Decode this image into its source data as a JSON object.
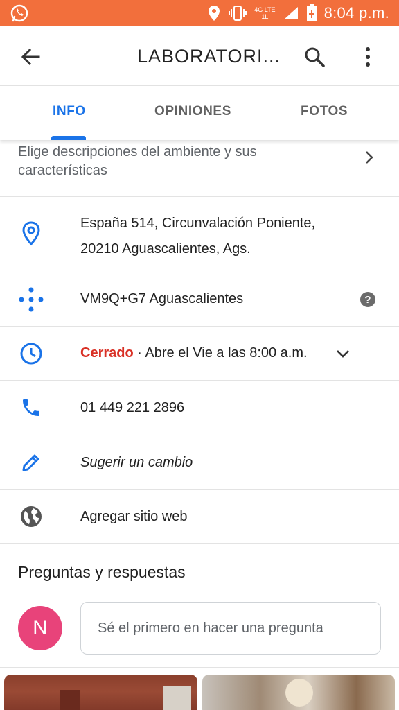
{
  "status_bar": {
    "time": "8:04 p.m.",
    "network": "4G LTE",
    "network_sub": "1L",
    "color": "#f26f3c"
  },
  "app_bar": {
    "title": "LABORATORI..."
  },
  "tabs": [
    {
      "label": "INFO",
      "active": true
    },
    {
      "label": "OPINIONES",
      "active": false
    },
    {
      "label": "FOTOS",
      "active": false
    }
  ],
  "ambience": {
    "label": "Elige descripciones del ambiente y sus características"
  },
  "address": {
    "line1": "España 514, Circunvalación Poniente,",
    "line2": "20210 Aguascalientes, Ags."
  },
  "plus_code": {
    "value": "VM9Q+G7 Aguascalientes"
  },
  "hours": {
    "status": "Cerrado",
    "detail": " · Abre el Vie a las 8:00 a.m."
  },
  "phone": {
    "value": "01 449 221 2896"
  },
  "suggest_edit": {
    "label": "Sugerir un cambio"
  },
  "website": {
    "label": "Agregar sitio web"
  },
  "qa": {
    "title": "Preguntas y respuestas",
    "avatar_initial": "N",
    "placeholder": "Sé el primero en hacer una pregunta"
  },
  "colors": {
    "accent": "#1a73e8",
    "closed": "#d93025",
    "avatar": "#e8437a"
  }
}
